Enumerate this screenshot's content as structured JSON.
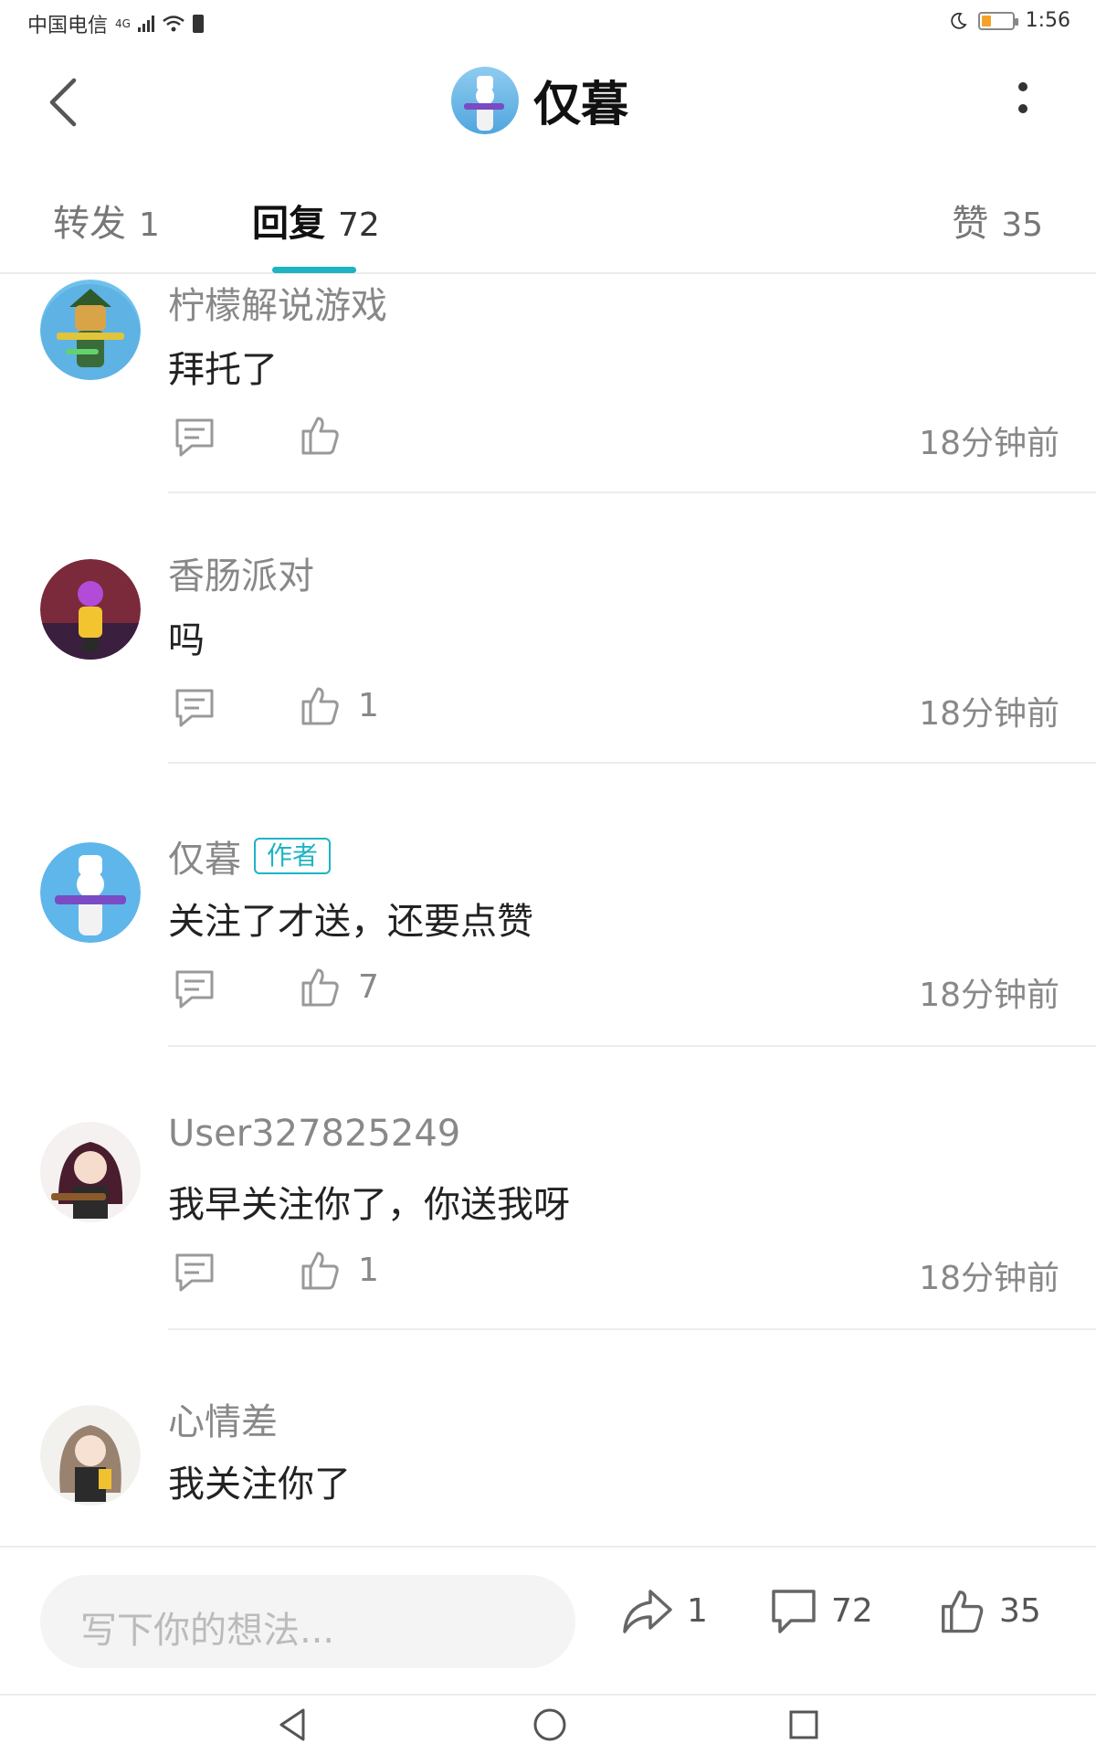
{
  "status_bar": {
    "carrier": "中国电信",
    "network_type": "4G",
    "time": "1:56"
  },
  "header": {
    "title": "仅暮",
    "back_icon": "chevron-left-icon",
    "more_icon": "more-vertical-icon"
  },
  "tabs": [
    {
      "label": "转发",
      "count": "1",
      "active": false
    },
    {
      "label": "回复",
      "count": "72",
      "active": true
    },
    {
      "label": "赞",
      "count": "35",
      "active": false
    }
  ],
  "colors": {
    "accent": "#1fb3c4",
    "muted_text": "#888888",
    "body_text": "#222222"
  },
  "comments": [
    {
      "username": "柠檬解说游戏",
      "is_author": false,
      "text": "拜托了",
      "likes": "",
      "time": "18分钟前"
    },
    {
      "username": "香肠派对",
      "is_author": false,
      "text": "吗",
      "likes": "1",
      "time": "18分钟前"
    },
    {
      "username": "仅暮",
      "is_author": true,
      "author_badge": "作者",
      "text": "关注了才送，还要点赞",
      "likes": "7",
      "time": "18分钟前"
    },
    {
      "username": "User327825249",
      "is_author": false,
      "text": "我早关注你了，你送我呀",
      "likes": "1",
      "time": "18分钟前"
    },
    {
      "username": "心情差",
      "is_author": false,
      "text": "我关注你了",
      "likes": "",
      "time": ""
    }
  ],
  "bottom_bar": {
    "input_placeholder": "写下你的想法...",
    "share_count": "1",
    "comment_count": "72",
    "like_count": "35"
  }
}
